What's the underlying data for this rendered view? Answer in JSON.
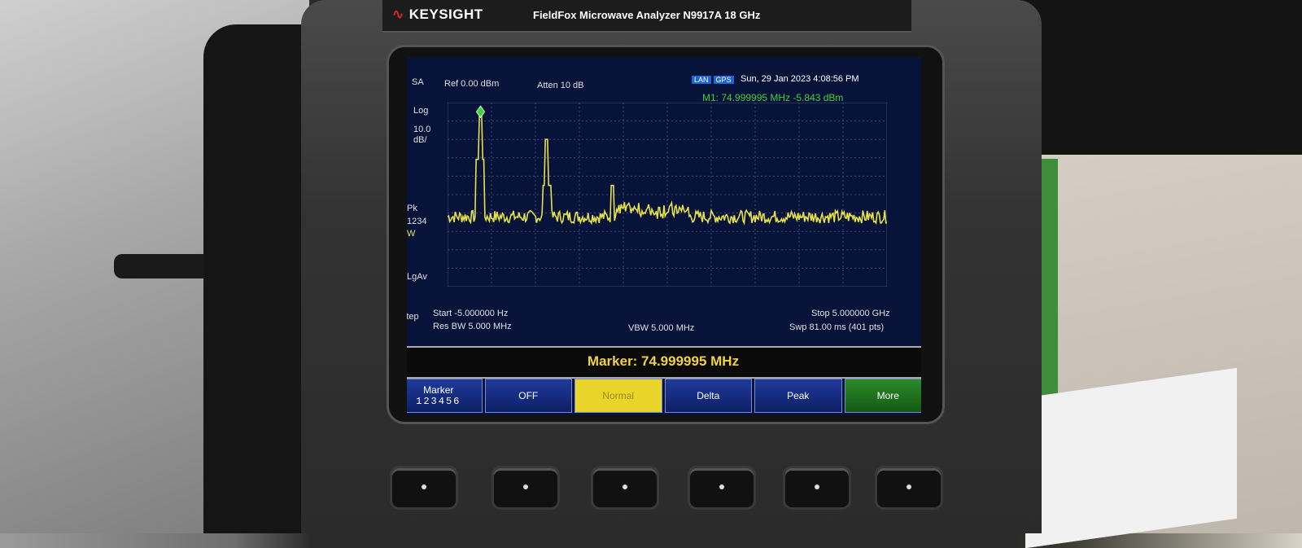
{
  "device": {
    "brand": "KEYSIGHT",
    "model": "FieldFox Microwave Analyzer   N9917A   18 GHz"
  },
  "screen": {
    "mode": "SA",
    "ref_level": "Ref 0.00 dBm",
    "atten": "Atten 10 dB",
    "status_icons": [
      "LAN",
      "GPS"
    ],
    "datetime": "Sun, 29 Jan 2023 4:08:56 PM",
    "marker_readout": "M1: 74.999995 MHz -5.843 dBm",
    "scale_type": "Log",
    "scale_div": "10.0",
    "scale_unit": "dB/",
    "detector": "Pk",
    "trace_sel": "1",
    "trace_rest": "234",
    "trace_mode": "W",
    "avg_type": "LgAv",
    "step_label": "Step",
    "start": "Start -5.000000  Hz",
    "stop": "Stop 5.000000 GHz",
    "res_bw": "Res BW 5.000 MHz",
    "vbw": "VBW 5.000 MHz",
    "sweep": "Swp 81.00 ms (401 pts)",
    "y_ticks": [
      "-10",
      "-20",
      "-30",
      "-40",
      "-50",
      "-60",
      "-70",
      "-80",
      "-90"
    ],
    "marker_banner": "Marker: 74.999995 MHz"
  },
  "softkeys": [
    {
      "label": "Marker",
      "sub": "123456",
      "state": "normal"
    },
    {
      "label": "OFF",
      "sub": "",
      "state": "normal"
    },
    {
      "label": "Normal",
      "sub": "",
      "state": "active"
    },
    {
      "label": "Delta",
      "sub": "",
      "state": "normal"
    },
    {
      "label": "Peak",
      "sub": "",
      "state": "normal"
    },
    {
      "label": "More",
      "sub": "",
      "state": "more"
    }
  ],
  "chart_data": {
    "type": "line",
    "ylim": [
      -100,
      0
    ],
    "trace_color": "#e6e04a",
    "grid_color": "#3a4a7a",
    "spikes": [
      {
        "x": 0.075,
        "y": -5.843
      },
      {
        "x": 0.225,
        "y": -20
      },
      {
        "x": 0.375,
        "y": -45
      }
    ],
    "noise_floor": -62
  }
}
